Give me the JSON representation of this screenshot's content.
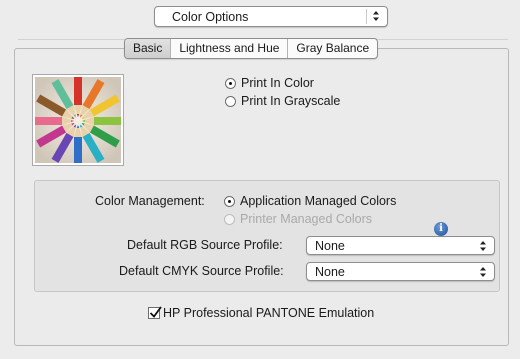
{
  "header": {
    "preset_popup": {
      "value": "Color Options"
    }
  },
  "tabs": [
    {
      "label": "Basic",
      "selected": true
    },
    {
      "label": "Lightness and Hue",
      "selected": false
    },
    {
      "label": "Gray Balance",
      "selected": false
    }
  ],
  "print_mode": {
    "options": [
      {
        "label": "Print In Color",
        "checked": true
      },
      {
        "label": "Print In Grayscale",
        "checked": false
      }
    ]
  },
  "color_management": {
    "label": "Color Management:",
    "options": [
      {
        "label": "Application Managed Colors",
        "checked": true,
        "enabled": true
      },
      {
        "label": "Printer Managed Colors",
        "checked": false,
        "enabled": false
      }
    ],
    "info_icon": "info-icon"
  },
  "rgb_profile": {
    "label": "Default RGB Source Profile:",
    "value": "None"
  },
  "cmyk_profile": {
    "label": "Default CMYK Source Profile:",
    "value": "None"
  },
  "pantone": {
    "label": "HP Professional PANTONE Emulation",
    "checked": true
  },
  "colors": {
    "background": "#ececec",
    "panel": "#ebebeb",
    "group": "#e3e3e3",
    "info_blue": "#1d4f9a"
  }
}
